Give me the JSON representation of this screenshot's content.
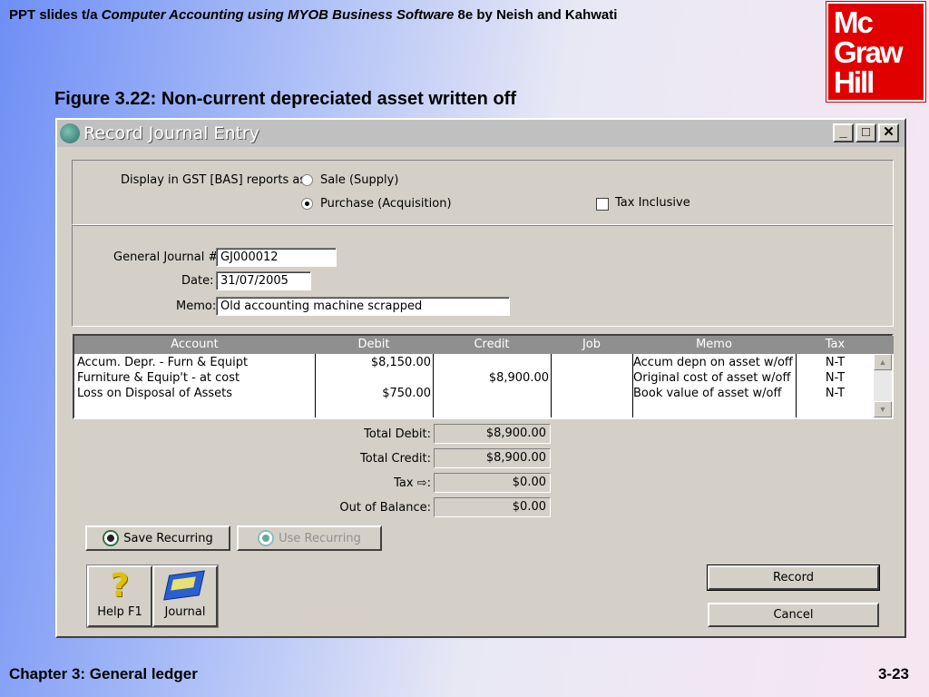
{
  "slide": {
    "header_prefix": "PPT slides t/a ",
    "header_book": "Computer Accounting using MYOB Business Software",
    "header_suffix": " 8e by Neish and Kahwati",
    "figure_title": "Figure 3.22: Non-current depreciated asset written off",
    "footer_left": "Chapter 3: General ledger",
    "footer_right": "3-23",
    "logo_lines": [
      "Mc",
      "Graw",
      "Hill"
    ]
  },
  "window": {
    "title": "Record Journal Entry",
    "minimize": "_",
    "maximize": "□",
    "close": "✕"
  },
  "gst": {
    "label": "Display in GST [BAS] reports as:",
    "option_sale": "Sale (Supply)",
    "option_purchase": "Purchase (Acquisition)",
    "selected": "purchase",
    "tax_inclusive_label": "Tax Inclusive",
    "tax_inclusive_checked": false
  },
  "form": {
    "journal_label": "General Journal #:",
    "journal_value": "GJ000012",
    "date_label": "Date:",
    "date_value": "31/07/2005",
    "memo_label": "Memo:",
    "memo_value": "Old accounting machine scrapped"
  },
  "grid": {
    "headers": {
      "account": "Account",
      "debit": "Debit",
      "credit": "Credit",
      "job": "Job",
      "memo": "Memo",
      "tax": "Tax"
    },
    "rows": [
      {
        "account": "Accum. Depr. - Furn & Equipt",
        "debit": "$8,150.00",
        "credit": "",
        "job": "",
        "memo": "Accum depn on asset w/off",
        "tax": "N-T"
      },
      {
        "account": "Furniture & Equip't  - at cost",
        "debit": "",
        "credit": "$8,900.00",
        "job": "",
        "memo": "Original cost of asset w/off",
        "tax": "N-T"
      },
      {
        "account": "Loss on Disposal of Assets",
        "debit": "$750.00",
        "credit": "",
        "job": "",
        "memo": "Book value of asset w/off",
        "tax": "N-T"
      }
    ]
  },
  "totals": {
    "total_debit_label": "Total Debit:",
    "total_debit": "$8,900.00",
    "total_credit_label": "Total Credit:",
    "total_credit": "$8,900.00",
    "tax_label": "Tax",
    "tax_arrow": "⇨",
    "tax_colon": ":",
    "tax": "$0.00",
    "out_of_balance_label": "Out of Balance:",
    "out_of_balance": "$0.00"
  },
  "buttons": {
    "save_recurring": "Save Recurring",
    "use_recurring": "Use Recurring",
    "help": "Help F1",
    "journal": "Journal",
    "record": "Record",
    "cancel": "Cancel"
  },
  "colors": {
    "window_bg": "#d4d0c8",
    "grid_header": "#8f8f8f",
    "logo_red": "#e00000"
  }
}
